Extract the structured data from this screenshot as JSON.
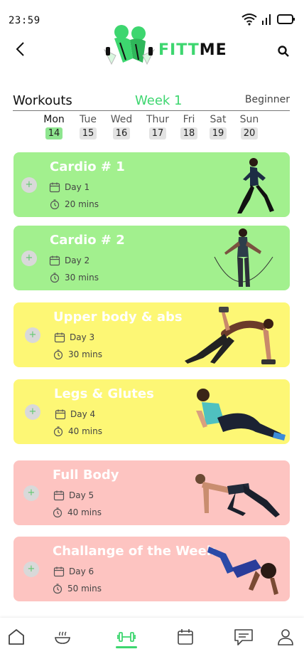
{
  "status_bar": {
    "time": "23:59"
  },
  "brand": {
    "fit": "FITT",
    "me": "ME",
    "accent": "#3dd66f"
  },
  "week": {
    "title": "Workouts",
    "week_label": "Week 1",
    "level": "Beginner",
    "days": [
      {
        "name": "Mon",
        "date": "14",
        "active": true
      },
      {
        "name": "Tue",
        "date": "15"
      },
      {
        "name": "Wed",
        "date": "16"
      },
      {
        "name": "Thur",
        "date": "17"
      },
      {
        "name": "Fri",
        "date": "18"
      },
      {
        "name": "Sat",
        "date": "19"
      },
      {
        "name": "Sun",
        "date": "20"
      }
    ]
  },
  "workouts": [
    {
      "title": "Cardio # 1",
      "day": "Day 1",
      "duration": "20 mins",
      "color": "#a2f08e"
    },
    {
      "title": "Cardio # 2",
      "day": "Day 2",
      "duration": "30 mins",
      "color": "#a2f08e"
    },
    {
      "title": "Upper body & abs",
      "day": "Day 3",
      "duration": "30 mins",
      "color": "#fdf775"
    },
    {
      "title": "Legs & Glutes",
      "day": "Day 4",
      "duration": "40 mins",
      "color": "#fdf775"
    },
    {
      "title": "Full Body",
      "day": "Day 5",
      "duration": "40 mins",
      "color": "#fdc4c1"
    },
    {
      "title": "Challange of the Week",
      "day": "Day 6",
      "duration": "50 mins",
      "color": "#fdc4c1"
    }
  ],
  "card_plus": "+",
  "tabbar": {
    "items": [
      "home-icon",
      "meal-icon",
      "workout-icon",
      "calendar-icon",
      "chat-icon",
      "profile-icon"
    ],
    "active": "workout-icon"
  }
}
